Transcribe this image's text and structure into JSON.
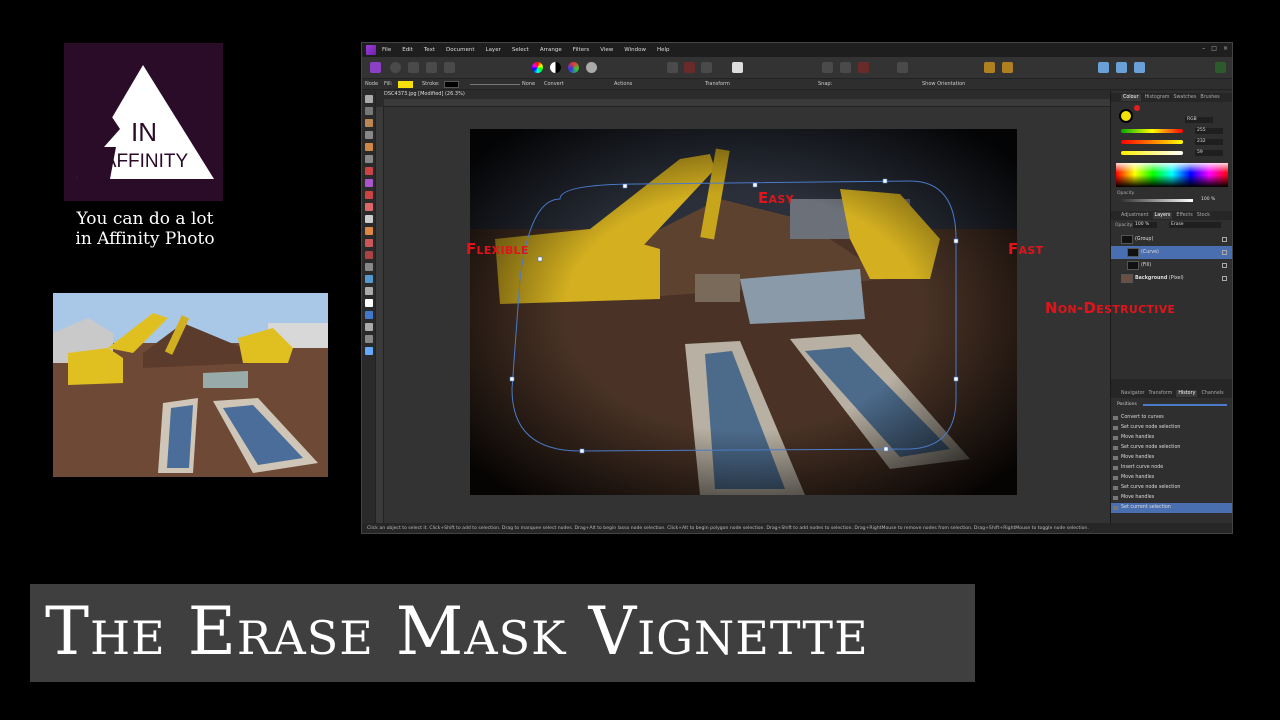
{
  "logo": {
    "line1": "IN",
    "line2": "AFFINITY"
  },
  "tagline": [
    "You can do a lot",
    "in Affinity Photo"
  ],
  "banner_title": "The Erase Mask Vignette",
  "app": {
    "menu": [
      "File",
      "Edit",
      "Text",
      "Document",
      "Layer",
      "Select",
      "Arrange",
      "Filters",
      "View",
      "Window",
      "Help"
    ],
    "document_tab": "DSC4373.jpg [Modified] (26.3%)",
    "context": {
      "node_label": "Node",
      "fill_label": "Fill:",
      "fill_color": "#f5e00a",
      "stroke_label": "Stroke:",
      "stroke_color": "#000000",
      "none_label": "None",
      "convert_label": "Convert",
      "actions_label": "Actions",
      "transform_label": "Transform",
      "snap_label": "Snap:",
      "show_orientation": "Show Orientation"
    },
    "overlay_words": {
      "easy": "Easy",
      "flexible": "Flexible",
      "fast": "Fast",
      "nondestructive": "Non-Destructive"
    },
    "status_text": "Click an object to select it. Click+Shift to add to selection. Drag to marquee select nodes. Drag+Alt to begin lasso node selection. Click+Alt to begin polygon node selection. Drag+Shift to add nodes to selection. Drag+RightMouse to remove nodes from selection. Drag+Shift+RightMouse to toggle node selection.",
    "colour_panel": {
      "tabs": [
        "Colour",
        "Histogram",
        "Swatches",
        "Brushes"
      ],
      "active_tab": "Colour",
      "model": "RGB",
      "r": "255",
      "g": "232",
      "b": "59",
      "opacity_label": "Opacity",
      "opacity_value": "100 %"
    },
    "layers_panel": {
      "tabs": [
        "Adjustment",
        "Layers",
        "Effects",
        "Stock"
      ],
      "active_tab": "Layers",
      "opacity_label": "Opacity:",
      "opacity_value": "100 %",
      "blend_mode": "Erase",
      "layers": [
        {
          "name": "(Group)"
        },
        {
          "name": "(Curve)"
        },
        {
          "name": "(Fill)"
        },
        {
          "name": "Background",
          "suffix": "(Pixel)"
        }
      ]
    },
    "history_panel": {
      "tabs": [
        "Navigator",
        "Transform",
        "History",
        "Channels"
      ],
      "active_tab": "History",
      "positions_label": "Positions",
      "items": [
        "Convert to curves",
        "Set curve node selection",
        "Move handles",
        "Set curve node selection",
        "Move handles",
        "Insert curve node",
        "Move handles",
        "Set curve node selection",
        "Move handles",
        "Set current selection"
      ]
    }
  }
}
